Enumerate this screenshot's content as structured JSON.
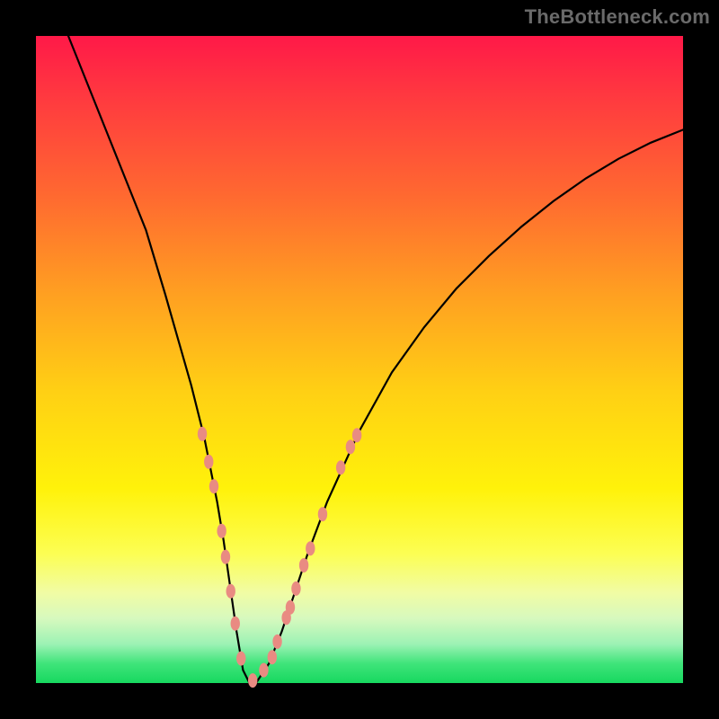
{
  "watermark": "TheBottleneck.com",
  "chart_data": {
    "type": "line",
    "title": "",
    "xlabel": "",
    "ylabel": "",
    "xlim": [
      0,
      100
    ],
    "ylim": [
      0,
      100
    ],
    "grid": false,
    "legend": false,
    "series": [
      {
        "name": "curve",
        "color": "#000000",
        "stroke_width": 2.2,
        "x": [
          5,
          8,
          11,
          14,
          17,
          20,
          22,
          24,
          26,
          28,
          29,
          30,
          31,
          32,
          33,
          34,
          36,
          38,
          40,
          42,
          45,
          50,
          55,
          60,
          65,
          70,
          75,
          80,
          85,
          90,
          95,
          100
        ],
        "y": [
          100,
          92.5,
          85,
          77.5,
          70,
          60,
          53,
          46,
          38,
          28,
          22,
          15,
          8,
          2,
          0,
          0,
          3,
          8,
          14,
          20,
          28,
          39,
          48,
          55,
          61,
          66,
          70.5,
          74.5,
          78,
          81,
          83.5,
          85.5
        ]
      },
      {
        "name": "marker-dots",
        "color": "#e98b82",
        "shape": "ellipse",
        "rx": 5.2,
        "ry": 8,
        "points": [
          {
            "x": 25.7,
            "y": 38.5
          },
          {
            "x": 26.7,
            "y": 34.2
          },
          {
            "x": 27.5,
            "y": 30.4
          },
          {
            "x": 28.7,
            "y": 23.5
          },
          {
            "x": 29.3,
            "y": 19.5
          },
          {
            "x": 30.1,
            "y": 14.2
          },
          {
            "x": 30.8,
            "y": 9.2
          },
          {
            "x": 31.7,
            "y": 3.8
          },
          {
            "x": 33.5,
            "y": 0.4
          },
          {
            "x": 35.2,
            "y": 2.0
          },
          {
            "x": 36.5,
            "y": 4.0
          },
          {
            "x": 37.3,
            "y": 6.4
          },
          {
            "x": 38.7,
            "y": 10.1
          },
          {
            "x": 39.3,
            "y": 11.7
          },
          {
            "x": 40.2,
            "y": 14.6
          },
          {
            "x": 41.4,
            "y": 18.2
          },
          {
            "x": 42.4,
            "y": 20.8
          },
          {
            "x": 44.3,
            "y": 26.1
          },
          {
            "x": 47.1,
            "y": 33.3
          },
          {
            "x": 48.6,
            "y": 36.5
          },
          {
            "x": 49.6,
            "y": 38.3
          }
        ]
      }
    ]
  }
}
